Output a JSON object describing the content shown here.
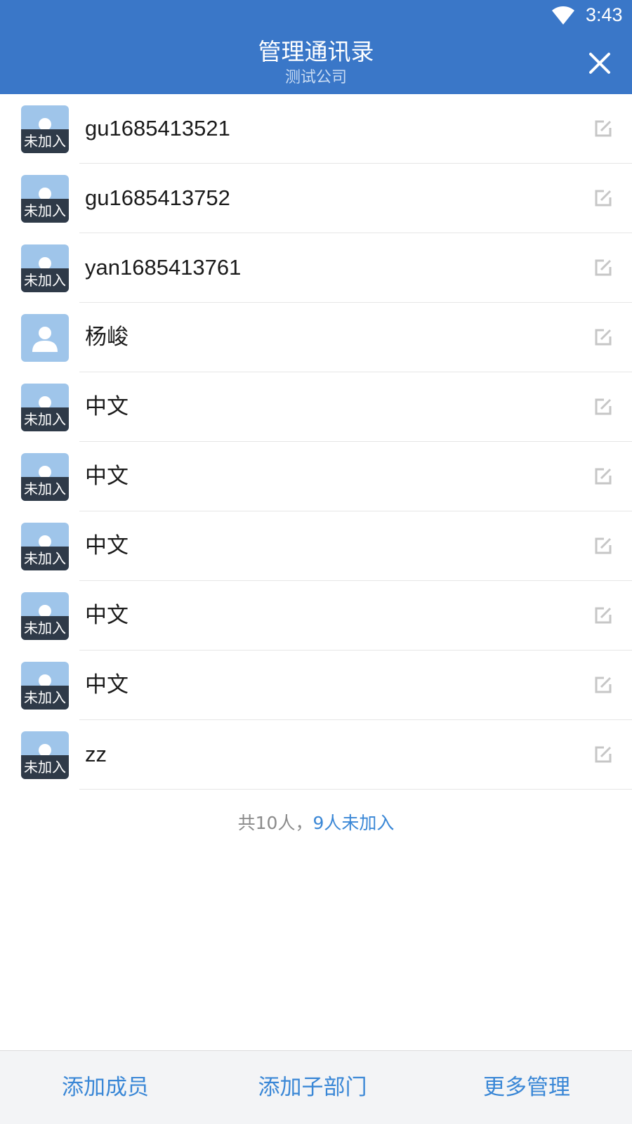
{
  "status_bar": {
    "time": "3:43",
    "wifi_icon": "wifi-icon"
  },
  "header": {
    "title": "管理通讯录",
    "subtitle": "测试公司",
    "close_icon": "close-icon",
    "background": "#3a77c8"
  },
  "members": [
    {
      "name": "gu1685413521",
      "status": "未加入"
    },
    {
      "name": "gu1685413752",
      "status": "未加入"
    },
    {
      "name": "yan1685413761",
      "status": "未加入"
    },
    {
      "name": "杨峻",
      "status": ""
    },
    {
      "name": "中文",
      "status": "未加入"
    },
    {
      "name": "中文",
      "status": "未加入"
    },
    {
      "name": "中文",
      "status": "未加入"
    },
    {
      "name": "中文",
      "status": "未加入"
    },
    {
      "name": "中文",
      "status": "未加入"
    },
    {
      "name": "zz",
      "status": "未加入"
    }
  ],
  "summary": {
    "total_text": "共10人，",
    "pending_text": "9人未加入"
  },
  "bottom_bar": {
    "add_member": "添加成员",
    "add_subdept": "添加子部门",
    "more_manage": "更多管理"
  },
  "colors": {
    "accent": "#3a87d6",
    "avatar_bg": "#9fc5ea",
    "badge_bg": "#2f3a48"
  }
}
